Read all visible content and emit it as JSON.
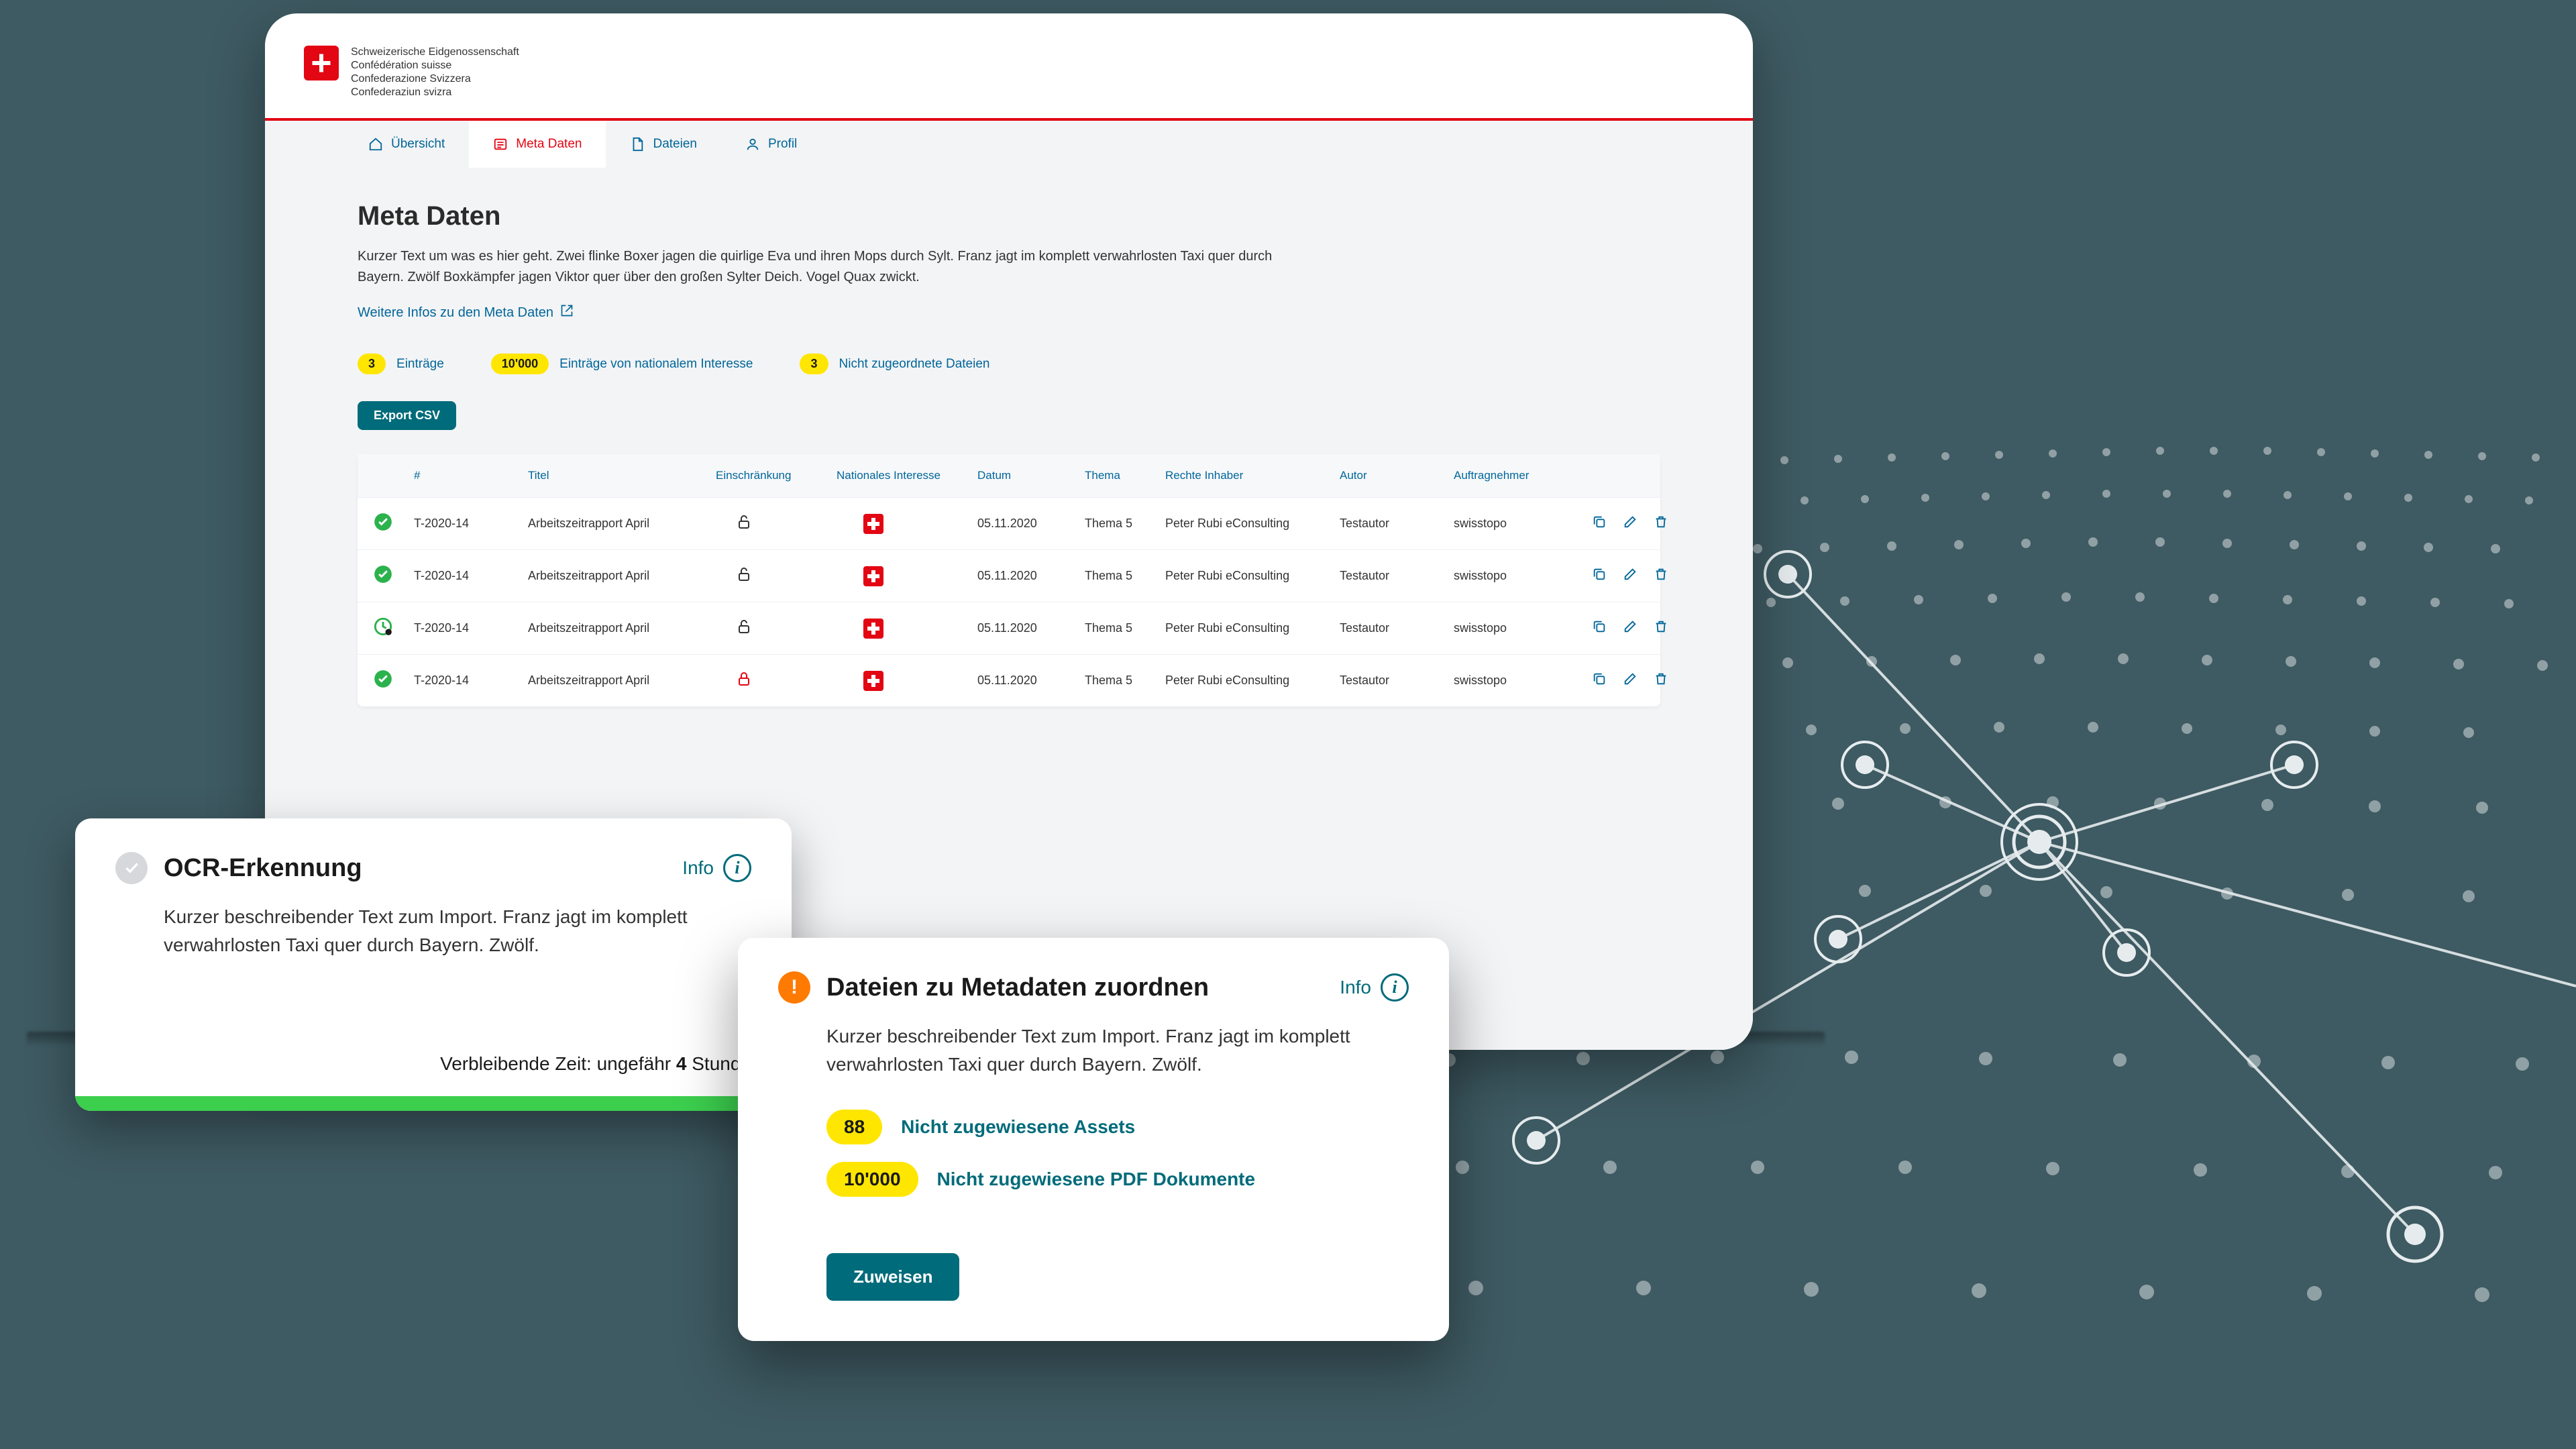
{
  "brand": {
    "line1": "Schweizerische Eidgenossenschaft",
    "line2": "Confédération suisse",
    "line3": "Confederazione Svizzera",
    "line4": "Confederaziun svizra"
  },
  "tabs": {
    "overview": "Übersicht",
    "metadata": "Meta Daten",
    "files": "Dateien",
    "profile": "Profil"
  },
  "page": {
    "title": "Meta Daten",
    "lead": "Kurzer Text um was es hier geht. Zwei flinke Boxer jagen die quirlige Eva und ihren Mops durch Sylt. Franz jagt im komplett verwahrlosten Taxi quer durch Bayern. Zwölf Boxkämpfer jagen Viktor quer über den großen Sylter Deich. Vogel Quax zwickt.",
    "info_link": "Weitere Infos zu den Meta Daten"
  },
  "summary": {
    "count1": "3",
    "label1": "Einträge",
    "count2": "10'000",
    "label2": "Einträge von nationalem Interesse",
    "count3": "3",
    "label3": "Nicht zugeordnete Dateien"
  },
  "buttons": {
    "export": "Export CSV",
    "assign": "Zuweisen"
  },
  "table": {
    "headers": {
      "id": "#",
      "title": "Titel",
      "restriction": "Einschränkung",
      "national": "Nationales Interesse",
      "date": "Datum",
      "topic": "Thema",
      "owner": "Rechte Inhaber",
      "author": "Autor",
      "contractor": "Auftragnehmer"
    },
    "rows": [
      {
        "status": "ok",
        "id": "T-2020-14",
        "title": "Arbeitszeitrapport April",
        "lock": "open",
        "date": "05.11.2020",
        "topic": "Thema 5",
        "owner": "Peter Rubi eConsulting",
        "author": "Testautor",
        "contractor": "swisstopo"
      },
      {
        "status": "ok",
        "id": "T-2020-14",
        "title": "Arbeitszeitrapport April",
        "lock": "open",
        "date": "05.11.2020",
        "topic": "Thema 5",
        "owner": "Peter Rubi eConsulting",
        "author": "Testautor",
        "contractor": "swisstopo"
      },
      {
        "status": "sync",
        "id": "T-2020-14",
        "title": "Arbeitszeitrapport April",
        "lock": "open",
        "date": "05.11.2020",
        "topic": "Thema 5",
        "owner": "Peter Rubi eConsulting",
        "author": "Testautor",
        "contractor": "swisstopo"
      },
      {
        "status": "ok",
        "id": "T-2020-14",
        "title": "Arbeitszeitrapport April",
        "lock": "closed",
        "date": "05.11.2020",
        "topic": "Thema 5",
        "owner": "Peter Rubi eConsulting",
        "author": "Testautor",
        "contractor": "swisstopo"
      }
    ]
  },
  "ocr": {
    "title": "OCR-Erkennung",
    "info": "Info",
    "body": "Kurzer beschreibender Text zum Import. Franz jagt im komplett verwahrlosten Taxi quer durch Bayern. Zwölf.",
    "remaining_prefix": "Verbleibende Zeit: ungefähr ",
    "remaining_hours": "4",
    "remaining_suffix": " Stunde"
  },
  "assign": {
    "title": "Dateien zu Metadaten zuordnen",
    "info": "Info",
    "body": "Kurzer beschreibender Text zum Import. Franz jagt im komplett verwahrlosten Taxi quer durch Bayern. Zwölf.",
    "stat1_count": "88",
    "stat1_label": "Nicht zugewiesene Assets",
    "stat2_count": "10'000",
    "stat2_label": "Nicht zugewiesene PDF Dokumente"
  }
}
